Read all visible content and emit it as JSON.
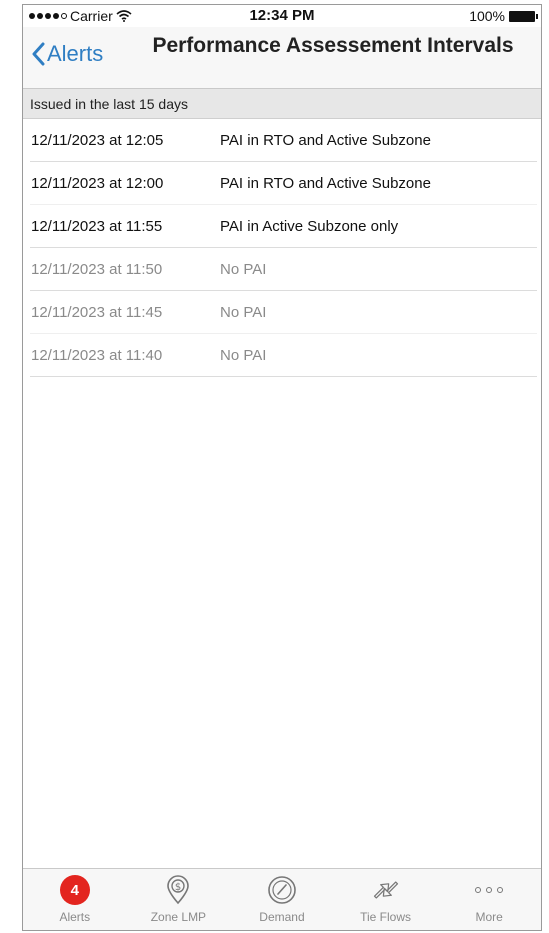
{
  "status_bar": {
    "carrier": "Carrier",
    "time": "12:34 PM",
    "battery": "100%"
  },
  "nav": {
    "back_label": "Alerts",
    "title": "Performance Assessement Intervals"
  },
  "section": {
    "header": "Issued in the last 15 days"
  },
  "alerts": [
    {
      "time": "12/11/2023 at 12:05",
      "description": "PAI in RTO and Active Subzone",
      "active": true
    },
    {
      "time": "12/11/2023 at 12:00",
      "description": "PAI in RTO and Active Subzone",
      "active": true
    },
    {
      "time": "12/11/2023 at 11:55",
      "description": "PAI in Active Subzone only",
      "active": true
    },
    {
      "time": "12/11/2023 at 11:50",
      "description": "No PAI",
      "active": false
    },
    {
      "time": "12/11/2023 at 11:45",
      "description": "No PAI",
      "active": false
    },
    {
      "time": "12/11/2023 at 11:40",
      "description": "No PAI",
      "active": false
    }
  ],
  "tab_bar": {
    "tabs": [
      {
        "label": "Alerts",
        "icon": "alert-badge-icon",
        "badge": "4"
      },
      {
        "label": "Zone LMP",
        "icon": "map-pin-dollar-icon"
      },
      {
        "label": "Demand",
        "icon": "gauge-icon"
      },
      {
        "label": "Tie Flows",
        "icon": "arrows-exchange-icon"
      },
      {
        "label": "More",
        "icon": "more-dots-icon"
      }
    ]
  },
  "colors": {
    "accent": "#2f7ec3",
    "badge": "#e3251f",
    "inactive_text": "#8a8a8a"
  }
}
